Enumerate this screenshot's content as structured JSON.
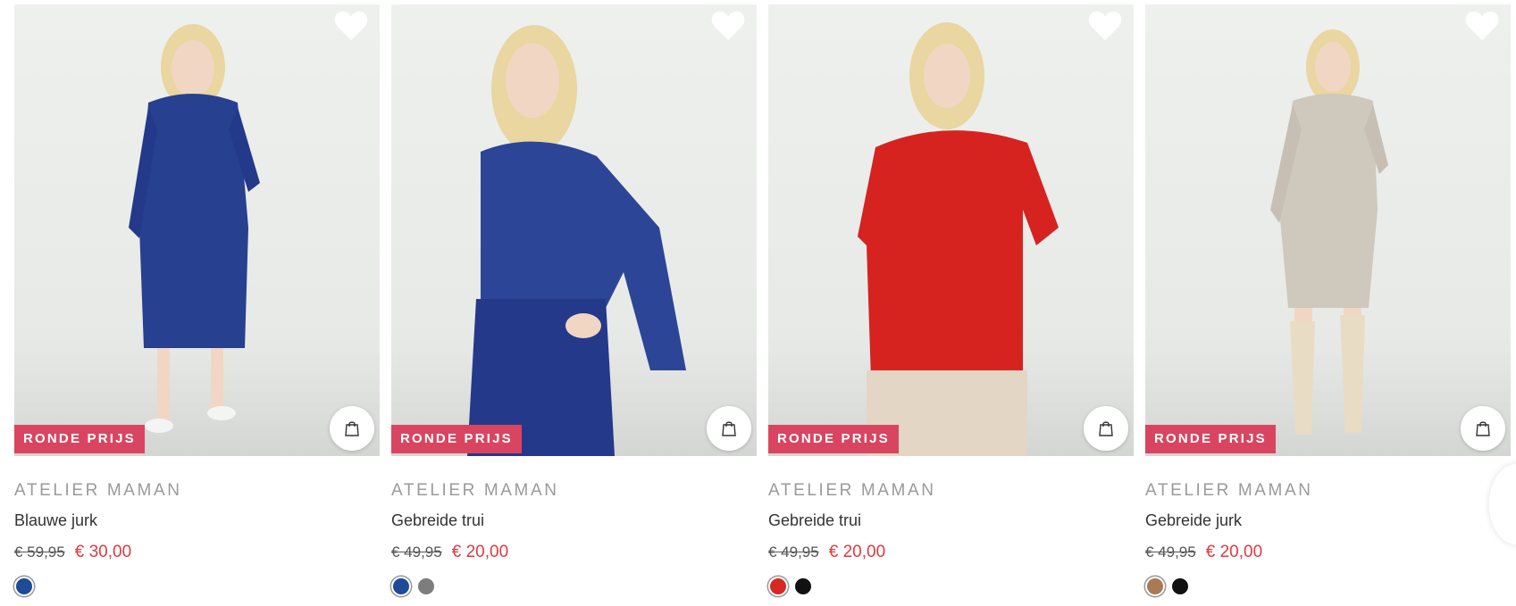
{
  "products": [
    {
      "badge": "RONDE PRIJS",
      "brand": "ATELIER MAMAN",
      "title": "Blauwe jurk",
      "old_price": "€ 59,95",
      "new_price": "€ 30,00",
      "garment_color": "#27408f",
      "swatches": [
        "#1f4a96"
      ]
    },
    {
      "badge": "RONDE PRIJS",
      "brand": "ATELIER MAMAN",
      "title": "Gebreide trui",
      "old_price": "€ 49,95",
      "new_price": "€ 20,00",
      "garment_color": "#2c4596",
      "swatches": [
        "#1f4a96",
        "#7d7d7d"
      ]
    },
    {
      "badge": "RONDE PRIJS",
      "brand": "ATELIER MAMAN",
      "title": "Gebreide trui",
      "old_price": "€ 49,95",
      "new_price": "€ 20,00",
      "garment_color": "#d6231f",
      "swatches": [
        "#d42a23",
        "#111111"
      ]
    },
    {
      "badge": "RONDE PRIJS",
      "brand": "ATELIER MAMAN",
      "title": "Gebreide jurk",
      "old_price": "€ 49,95",
      "new_price": "€ 20,00",
      "garment_color": "#cfc8bc",
      "swatches": [
        "#a87a56",
        "#111111"
      ]
    }
  ],
  "icons": {
    "wishlist": "heart-icon",
    "add_to_bag": "shopping-bag-icon"
  },
  "colors": {
    "badge_bg": "#d94560",
    "sale_price": "#e0393e",
    "brand_text": "#9a9a9a"
  }
}
